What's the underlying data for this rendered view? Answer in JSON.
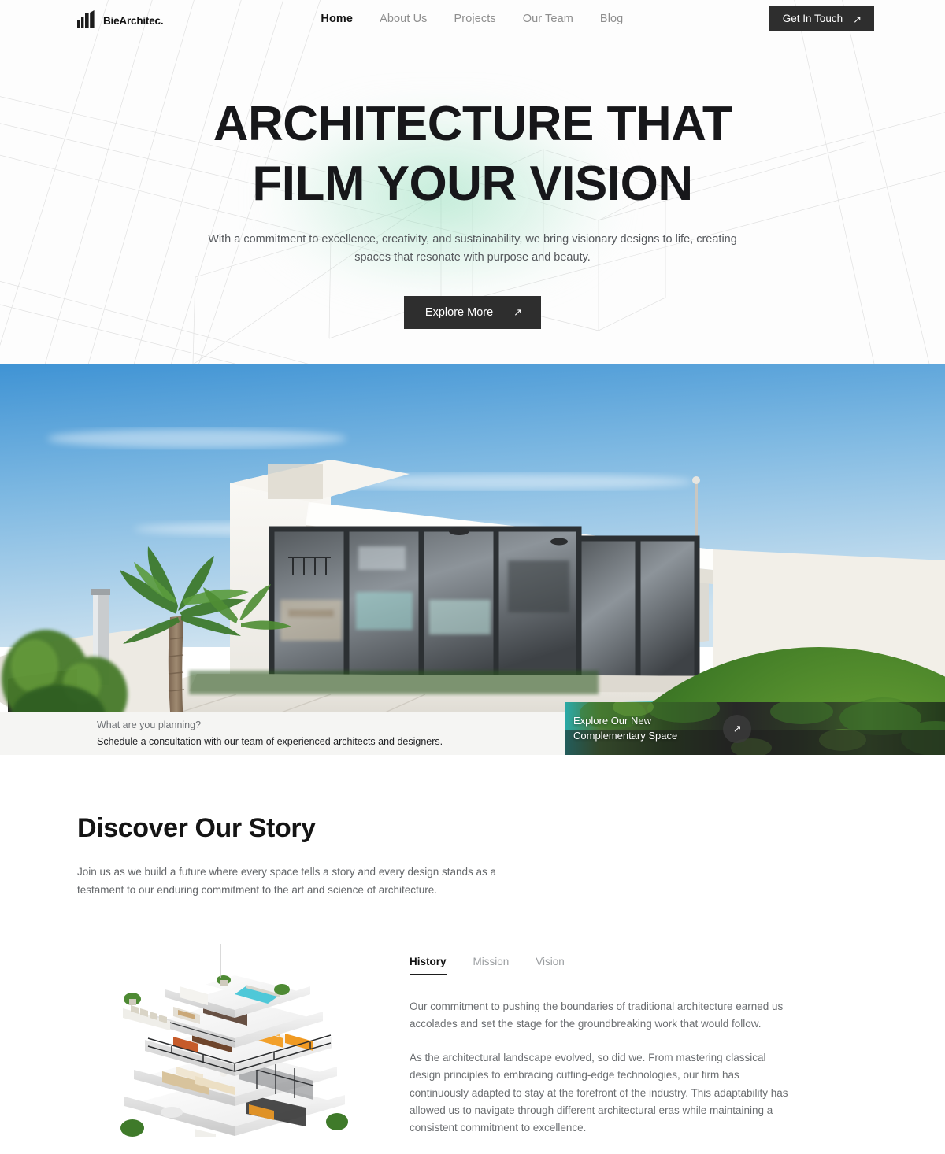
{
  "brand": {
    "name": "BieArchitec.",
    "logo_icon": "building-bars-icon"
  },
  "nav": {
    "items": [
      {
        "label": "Home",
        "active": true
      },
      {
        "label": "About Us",
        "active": false
      },
      {
        "label": "Projects",
        "active": false
      },
      {
        "label": "Our Team",
        "active": false
      },
      {
        "label": "Blog",
        "active": false
      }
    ],
    "cta": {
      "label": "Get In Touch",
      "icon": "arrow-up-right-icon"
    }
  },
  "hero": {
    "title_line1": "ARCHITECTURE THAT",
    "title_line2": "FILM YOUR VISION",
    "subtitle": "With a commitment to excellence, creativity, and sustainability, we bring visionary designs to life, creating spaces that resonate with purpose and beauty.",
    "button": {
      "label": "Explore More",
      "icon": "arrow-up-right-icon"
    },
    "glow_color": "#92debA",
    "background": "blueprint-wireframe-lines"
  },
  "showcase": {
    "alt": "modern white villa with sliding glass doors, palm trees and pool"
  },
  "consult": {
    "question": "What are you planning?",
    "answer": "Schedule a consultation with our team of experienced architects and designers.",
    "promo_line1": "Explore Our New",
    "promo_line2": "Complementary Space",
    "promo_icon": "arrow-up-right-icon"
  },
  "story": {
    "title": "Discover Our Story",
    "description": "Join us as we build a future where every space tells a story and every design stands as a testament to our enduring commitment to the art and science of architecture.",
    "figure_alt": "isometric cutaway render of a multi-storey apartment building",
    "tabs": [
      {
        "label": "History",
        "active": true
      },
      {
        "label": "Mission",
        "active": false
      },
      {
        "label": "Vision",
        "active": false
      }
    ],
    "paragraphs": [
      "Our commitment to pushing the boundaries of traditional architecture earned us accolades and set the stage for the groundbreaking work that would follow.",
      "As the architectural landscape evolved, so did we. From mastering classical design principles to embracing cutting-edge technologies, our firm has continuously adapted to stay at the forefront of the industry. This adaptability has allowed us to navigate through different architectural eras while maintaining a consistent commitment to excellence."
    ]
  },
  "colors": {
    "dark": "#2e2e2e",
    "text": "#1c1c1c",
    "muted": "#8e8e8e",
    "bar_bg": "#f5f5f3"
  }
}
